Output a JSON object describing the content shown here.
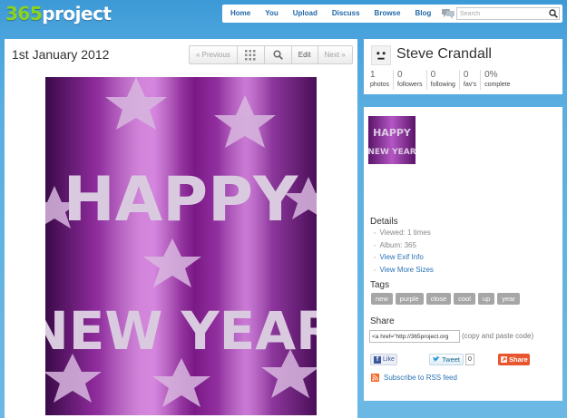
{
  "header": {
    "logo_number": "365",
    "logo_word": "project",
    "nav": [
      "Home",
      "You",
      "Upload",
      "Discuss",
      "Browse",
      "Blog"
    ],
    "search_placeholder": "Search"
  },
  "photo": {
    "date": "1st January 2012",
    "nav": {
      "previous": "« Previous",
      "edit": "Edit",
      "next": "Next »"
    },
    "image_text": [
      "HAPPY",
      "NEW YEAR"
    ]
  },
  "profile": {
    "name": "Steve Crandall",
    "stats": [
      {
        "value": "1",
        "label": "photos"
      },
      {
        "value": "0",
        "label": "followers"
      },
      {
        "value": "0",
        "label": "following"
      },
      {
        "value": "0",
        "label": "fav's"
      },
      {
        "value": "0%",
        "label": "complete"
      }
    ]
  },
  "details": {
    "title": "Details",
    "viewed": "Viewed: 1 times",
    "album": "Album: 365",
    "exif_link": "View Exif Info",
    "sizes_link": "View More Sizes"
  },
  "tags": {
    "title": "Tags",
    "items": [
      "new",
      "purple",
      "close",
      "cool",
      "up",
      "year"
    ]
  },
  "share": {
    "title": "Share",
    "code_value": "<a href=\"http://365project.org",
    "hint": "(copy and paste code)",
    "like_label": "Like",
    "tweet_label": "Tweet",
    "tweet_count": "0",
    "share_label": "Share",
    "rss_label": "Subscribe to RSS feed"
  },
  "colors": {
    "background": "#4aa3dc",
    "link": "#2a72b5",
    "nav_text": "#2068a8",
    "logo_green": "#8cd21e",
    "tag_bg": "#a6a6a6",
    "photo_purple": "#7a1a86"
  }
}
